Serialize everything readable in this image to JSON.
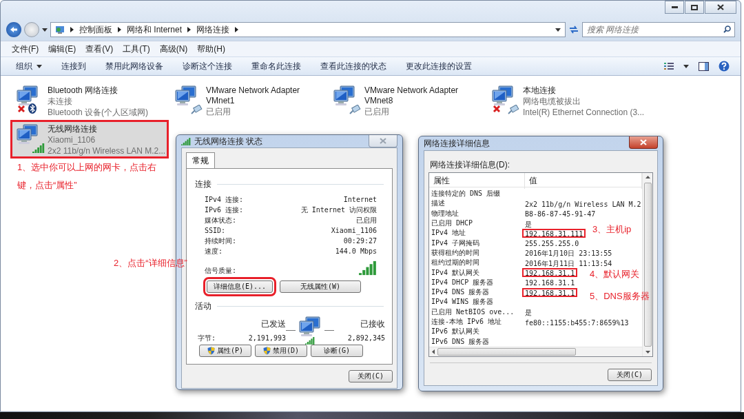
{
  "explorer": {
    "breadcrumb": [
      "控制面板",
      "网络和 Internet",
      "网络连接"
    ],
    "search": {
      "placeholder": "搜索 网络连接"
    },
    "menu": [
      "文件(F)",
      "编辑(E)",
      "查看(V)",
      "工具(T)",
      "高级(N)",
      "帮助(H)"
    ],
    "toolbar": [
      {
        "label": "组织",
        "dropdown": true
      },
      {
        "label": "连接到",
        "dropdown": false
      },
      {
        "label": "禁用此网络设备",
        "dropdown": false
      },
      {
        "label": "诊断这个连接",
        "dropdown": false
      },
      {
        "label": "重命名此连接",
        "dropdown": false
      },
      {
        "label": "查看此连接的状态",
        "dropdown": false
      },
      {
        "label": "更改此连接的设置",
        "dropdown": false
      }
    ],
    "connections": [
      {
        "name": "Bluetooth 网络连接",
        "details": [
          "未连接",
          "Bluetooth 设备(个人区域网)"
        ],
        "kind": "bluetooth",
        "disconnected": true,
        "selected": false,
        "highlighted": false
      },
      {
        "name": "VMware Network Adapter VMnet1",
        "details": [
          "已启用"
        ],
        "kind": "ethernet",
        "disconnected": false,
        "selected": false,
        "highlighted": false
      },
      {
        "name": "VMware Network Adapter VMnet8",
        "details": [
          "已启用"
        ],
        "kind": "ethernet",
        "disconnected": false,
        "selected": false,
        "highlighted": false
      },
      {
        "name": "本地连接",
        "details": [
          "网络电缆被拔出",
          "Intel(R) Ethernet Connection (3..."
        ],
        "kind": "ethernet",
        "disconnected": true,
        "selected": false,
        "highlighted": false
      },
      {
        "name": "无线网络连接",
        "details": [
          "Xiaomi_1106",
          "2x2 11b/g/n Wireless LAN M.2..."
        ],
        "kind": "wireless",
        "disconnected": false,
        "selected": true,
        "highlighted": true
      }
    ]
  },
  "status_dialog": {
    "title": "无线网络连接 状态",
    "tabs": [
      {
        "label": "常规",
        "selected": true
      }
    ],
    "connection_heading": "连接",
    "rows": [
      {
        "label": "IPv4 连接:",
        "value": "Internet"
      },
      {
        "label": "IPv6 连接:",
        "value": "无 Internet 访问权限"
      },
      {
        "label": "媒体状态:",
        "value": "已启用"
      },
      {
        "label": "SSID:",
        "value": "Xiaomi_1106"
      },
      {
        "label": "持续时间:",
        "value": "00:29:27"
      },
      {
        "label": "速度:",
        "value": "144.0 Mbps"
      }
    ],
    "signal_label": "信号质量:",
    "buttons": [
      {
        "label": "详细信息(E)...",
        "highlighted": true
      },
      {
        "label": "无线属性(W)",
        "highlighted": false
      }
    ],
    "activity_heading": "活动",
    "sent_label": "已发送",
    "received_label": "已接收",
    "bytes_label": "字节:",
    "bytes_sent": "2,191,993",
    "bytes_received": "2,892,345",
    "action_buttons": [
      {
        "label": "属性(P)",
        "shield": true
      },
      {
        "label": "禁用(D)",
        "shield": true
      },
      {
        "label": "诊断(G)",
        "shield": false
      }
    ],
    "close_button": "关闭(C)"
  },
  "details_dialog": {
    "title": "网络连接详细信息",
    "list_label": "网络连接详细信息(D):",
    "columns": [
      "属性",
      "值"
    ],
    "rows": [
      {
        "property": "连接特定的 DNS 后缀",
        "highlighted": false
      },
      {
        "property": "描述",
        "value": "2x2 11b/g/n Wireless LAN M.2",
        "highlighted": false
      },
      {
        "property": "物理地址",
        "value": "B8-86-87-45-91-47",
        "highlighted": false
      },
      {
        "property": "已启用 DHCP",
        "value": "是",
        "highlighted": false
      },
      {
        "property": "IPv4 地址",
        "value": "192.168.31.111",
        "highlighted": true
      },
      {
        "property": "IPv4 子网掩码",
        "value": "255.255.255.0",
        "highlighted": false
      },
      {
        "property": "获得租约的时间",
        "value": "2016年1月10日 23:13:55",
        "highlighted": false
      },
      {
        "property": "租约过期的时间",
        "value": "2016年1月11日 11:13:54",
        "highlighted": false
      },
      {
        "property": "IPv4 默认网关",
        "value": "192.168.31.1",
        "highlighted": true
      },
      {
        "property": "IPv4 DHCP 服务器",
        "value": "192.168.31.1",
        "highlighted": false
      },
      {
        "property": "IPv4 DNS 服务器",
        "value": "192.168.31.1",
        "highlighted": true
      },
      {
        "property": "IPv4 WINS 服务器",
        "highlighted": false
      },
      {
        "property": "已启用 NetBIOS ove...",
        "value": "是",
        "highlighted": false
      },
      {
        "property": "连接-本地 IPv6 地址",
        "value": "fe80::1155:b455:7:8659%13",
        "highlighted": false
      },
      {
        "property": "IPv6 默认网关",
        "highlighted": false
      },
      {
        "property": "IPv6 DNS 服务器",
        "highlighted": false
      }
    ],
    "close_button": "关闭(C)"
  },
  "annotations": [
    {
      "text": "1、选中你可以上网的网卡，点击右键，点击“属性”"
    },
    {
      "text": "2、点击“详细信息”"
    },
    {
      "text": "3、主机ip"
    },
    {
      "text": "4、默认网关"
    },
    {
      "text": "5、DNS服务器"
    }
  ]
}
